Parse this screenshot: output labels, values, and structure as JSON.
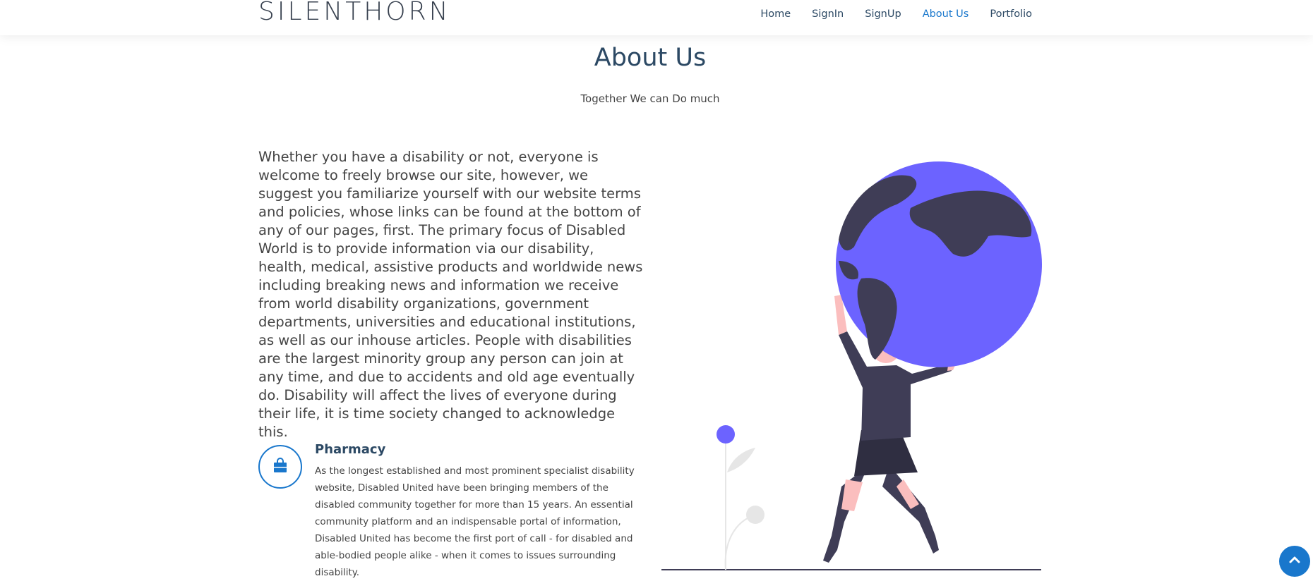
{
  "header": {
    "logo": "SILENTHORN",
    "nav": [
      {
        "label": "Home"
      },
      {
        "label": "SignIn"
      },
      {
        "label": "SignUp"
      },
      {
        "label": "About Us"
      },
      {
        "label": "Portfolio"
      }
    ],
    "active_nav": "About Us"
  },
  "section": {
    "title": "About Us",
    "subtitle": "Together We can Do much"
  },
  "intro": "Whether you have a disability or not, everyone is welcome to freely browse our site, however, we suggest you familiarize yourself with our website terms and policies, whose links can be found at the bottom of any of our pages, first. The primary focus of Disabled World is to provide information via our disability, health, medical, assistive products and worldwide news including breaking news and information we receive from world disability organizations, government departments, universities and educational institutions, as well as our inhouse articles. People with disabilities are the largest minority group any person can join at any time, and due to accidents and old age eventually do. Disability will affect the lives of everyone during their life, it is time society changed to acknowledge this.",
  "feature": {
    "icon": "shopping-bag-icon",
    "title": "Pharmacy",
    "description": "As the longest established and most prominent specialist disability website, Disabled United have been bringing members of the disabled community together for more than 15 years. An essential community platform and an indispensable portal of information, Disabled United has become the first port of call - for disabled and able-bodied people alike - when it comes to issues surrounding disability."
  },
  "colors": {
    "accent": "#1977cc",
    "heading": "#2c4964",
    "globe": "#6c63ff",
    "dark": "#3f3d56"
  },
  "back_to_top_icon": "chevron-up-icon"
}
